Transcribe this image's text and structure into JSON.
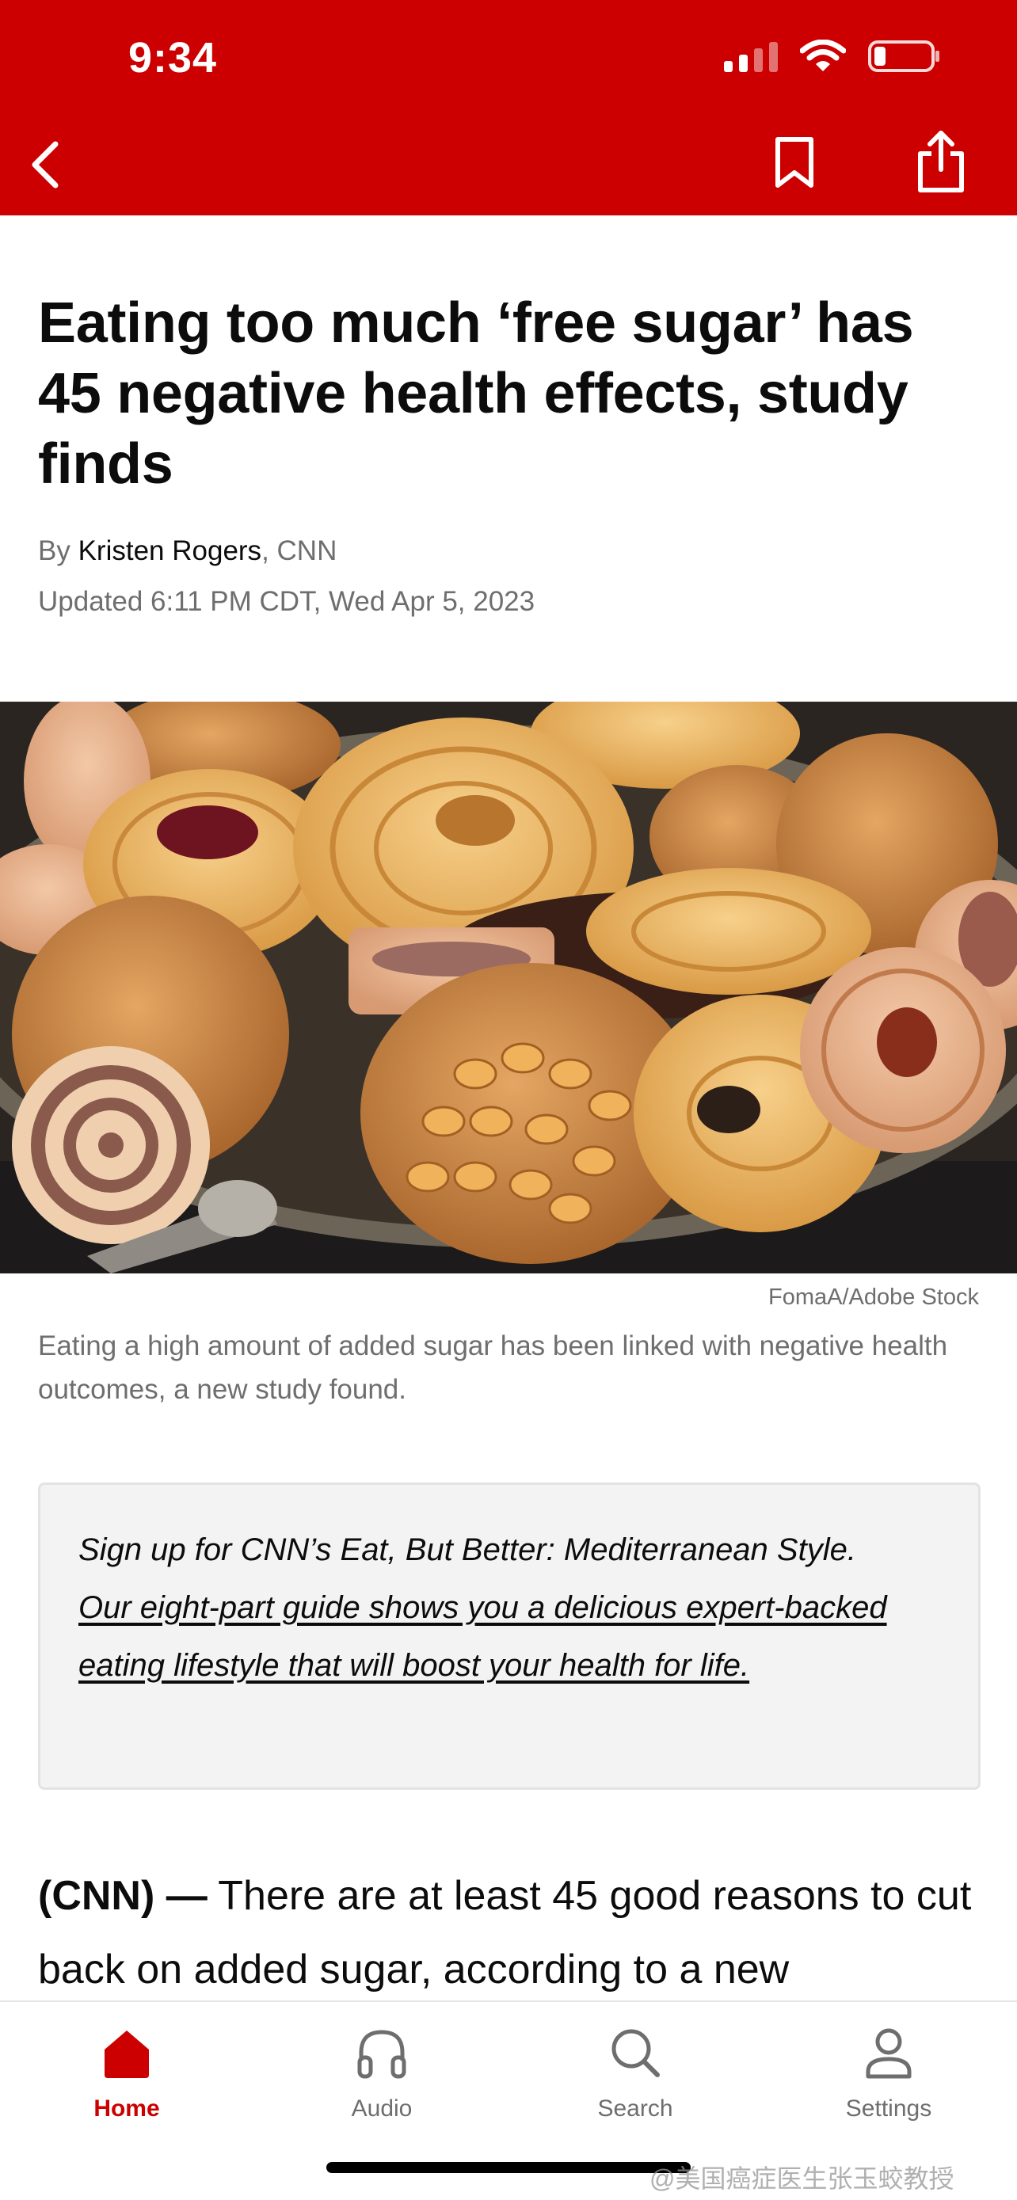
{
  "status_bar": {
    "time": "9:34"
  },
  "colors": {
    "brand_red": "#cc0000",
    "text_primary": "#0c0c0c",
    "text_secondary": "#6e6e6e"
  },
  "nav": {
    "back_icon": "chevron-left-icon",
    "bookmark_icon": "bookmark-icon",
    "share_icon": "share-icon"
  },
  "article": {
    "headline": "Eating too much ‘free sugar’ has 45 negative health effects, study finds",
    "byline_prefix": "By ",
    "author": "Kristen Rogers",
    "byline_suffix": ", CNN",
    "updated": "Updated 6:11 PM CDT, Wed Apr 5, 2023",
    "image_credit": "FomaA/Adobe Stock",
    "image_caption": "Eating a high amount of added sugar has been linked with negative health outcomes, a new study found.",
    "promo_intro": "Sign up for CNN’s Eat, But Better: Mediterranean Style.",
    "promo_link": "Our eight-part guide shows you a delicious expert-backed eating lifestyle that will boost your health for life.",
    "dateline": "(CNN) —",
    "lede": " There are at least 45 good reasons to cut back on added sugar, according to a new"
  },
  "tabbar": {
    "tabs": [
      {
        "label": "Home",
        "icon": "home-icon",
        "active": true
      },
      {
        "label": "Audio",
        "icon": "headphones-icon",
        "active": false
      },
      {
        "label": "Search",
        "icon": "search-icon",
        "active": false
      },
      {
        "label": "Settings",
        "icon": "person-icon",
        "active": false
      }
    ]
  },
  "watermark": "@美国癌症医生张玉蛟教授"
}
